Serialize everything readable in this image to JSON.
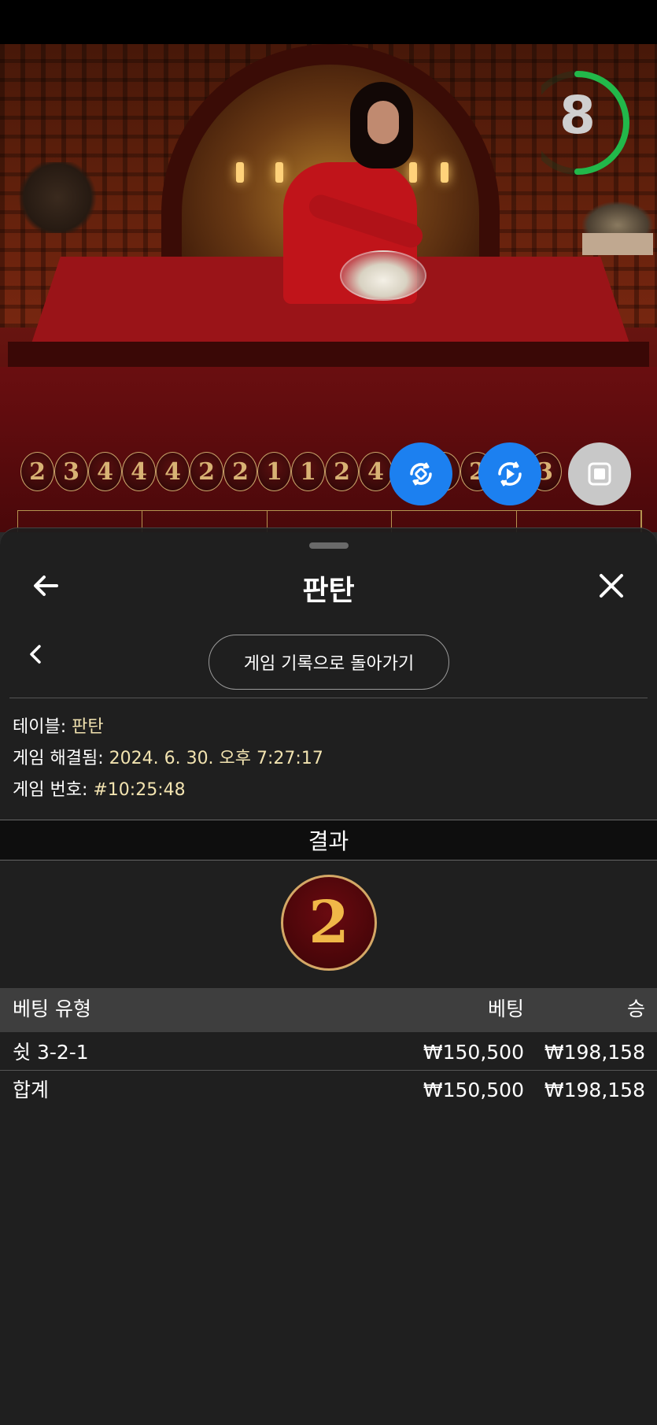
{
  "video": {
    "timer_value": "8",
    "timer_fraction": 0.5
  },
  "roadmap": {
    "beads": [
      "2",
      "3",
      "4",
      "4",
      "4",
      "2",
      "2",
      "1",
      "1",
      "2",
      "4",
      "",
      "3",
      "2",
      "",
      "3"
    ]
  },
  "controls": {
    "fab1_icon": "autoplay-icon",
    "fab2_icon": "replay-icon",
    "fab3_icon": "stop-icon",
    "accent": "#1c80f0"
  },
  "panel": {
    "title": "판탄",
    "back_icon": "arrow-left-icon",
    "close_icon": "close-icon",
    "prev_icon": "chevron-left-icon",
    "history_button": "게임 기록으로 돌아가기",
    "info": {
      "table_label": "테이블: ",
      "table_value": "판탄",
      "resolved_label": "게임 해결됨: ",
      "resolved_value": "2024. 6. 30. 오후 7:27:17",
      "game_no_label": "게임 번호: ",
      "game_no_value": "#10:25:48"
    },
    "result_header": "결과",
    "result_value": "2",
    "table": {
      "columns": [
        "베팅 유형",
        "베팅",
        "승"
      ],
      "rows": [
        {
          "type": "쉿 3-2-1",
          "bet": "₩150,500",
          "win": "₩198,158"
        }
      ],
      "total": {
        "type": "합계",
        "bet": "₩150,500",
        "win": "₩198,158"
      }
    }
  }
}
